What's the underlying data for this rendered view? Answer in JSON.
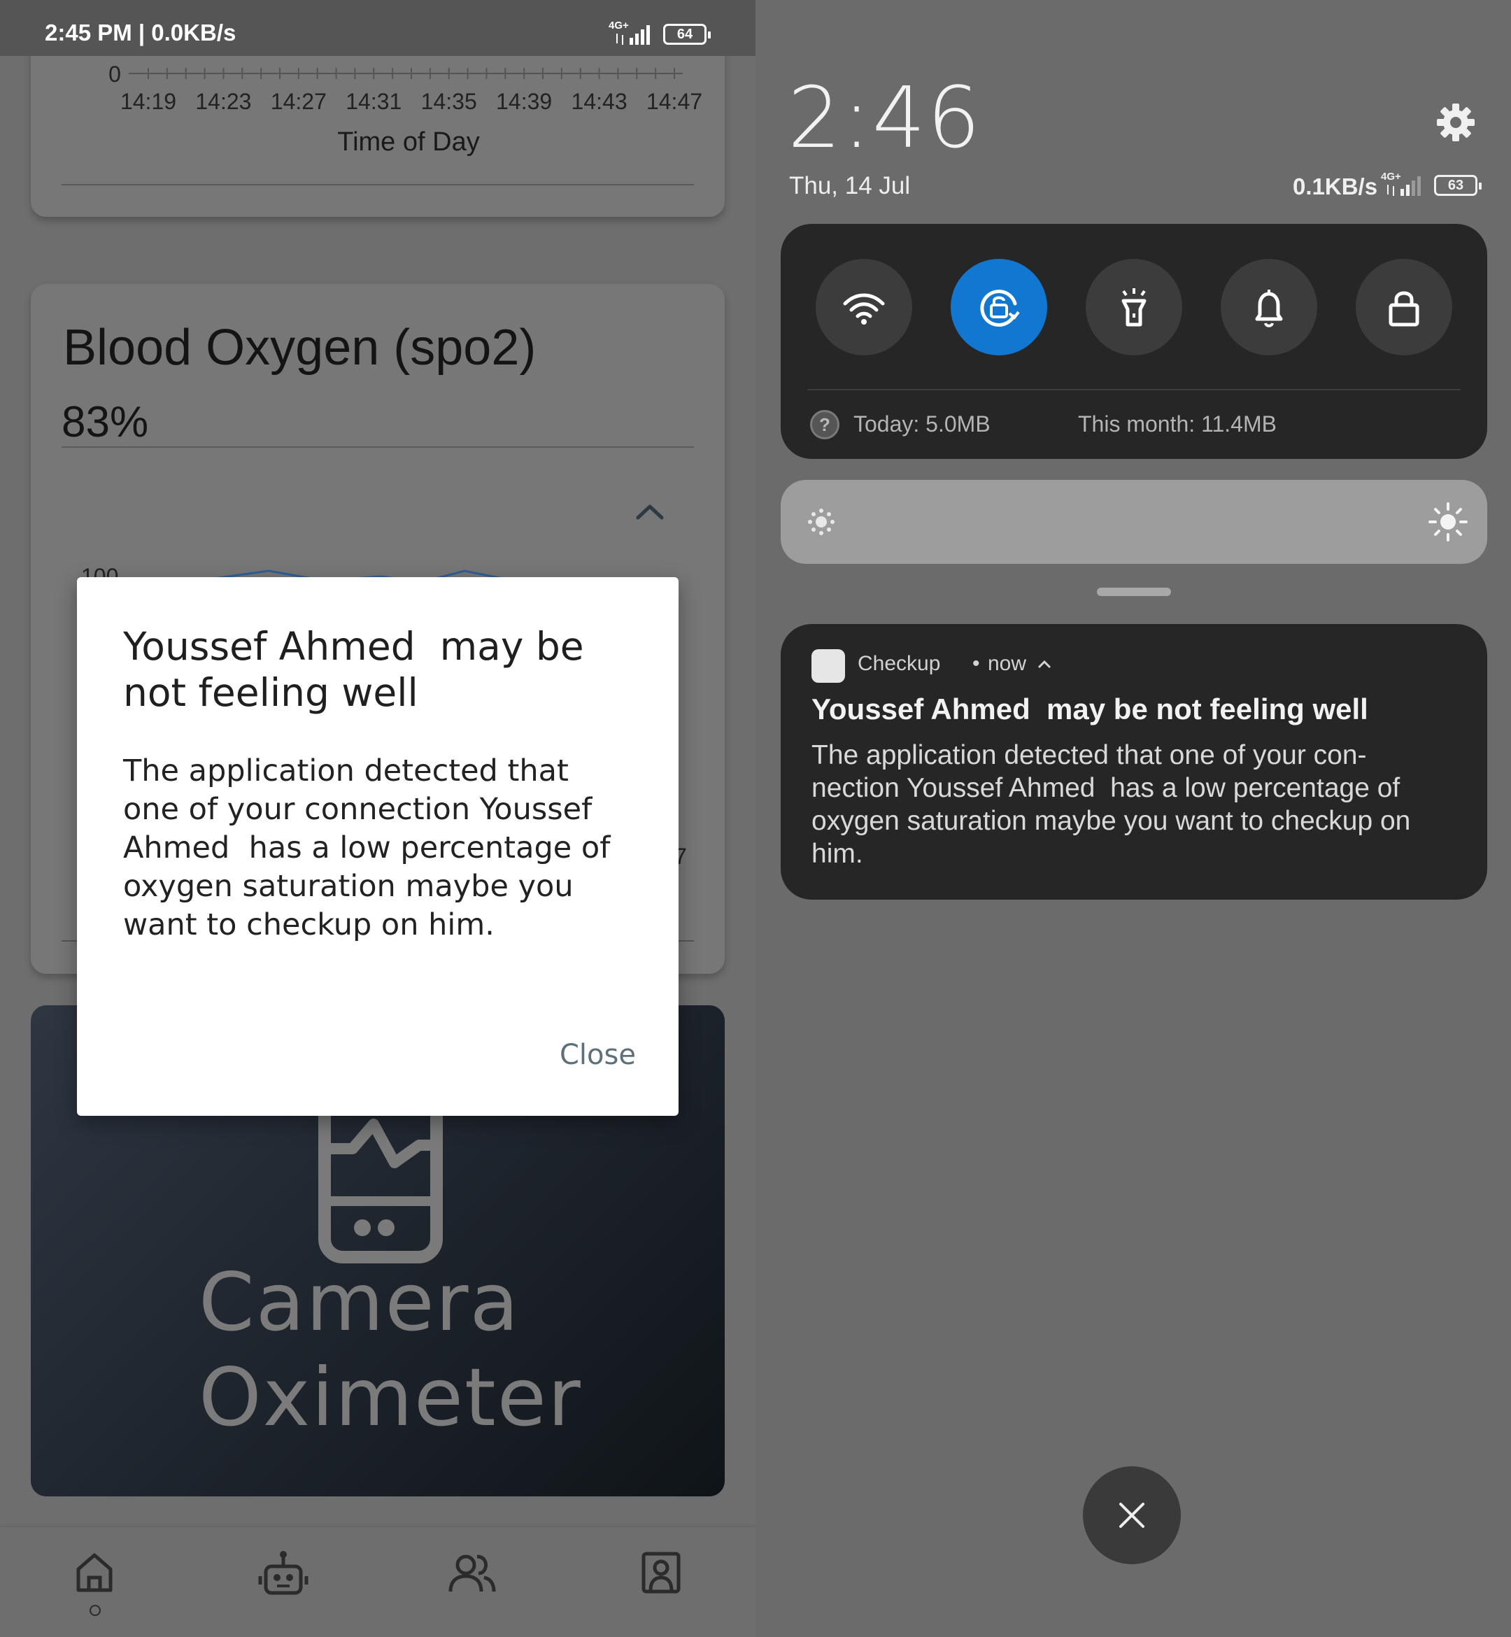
{
  "left_screen": {
    "status_bar": {
      "time_speed": "2:45 PM | 0.0KB/s",
      "network": "4G+",
      "battery": "64"
    },
    "top_chart_card": {
      "chart_data": {
        "type": "line",
        "x_ticks": [
          "14:19",
          "14:23",
          "14:27",
          "14:31",
          "14:35",
          "14:39",
          "14:43",
          "14:47"
        ],
        "y_ticks_visible": [
          0
        ],
        "xlabel": "Time of Day"
      }
    },
    "spo2_card": {
      "title": "Blood Oxygen (spo2)",
      "value": "83%",
      "chevron_icon": "chevron-up-icon",
      "partial_axis_label": "100",
      "partial_right_label": "7"
    },
    "camera_card": {
      "icon": "oximeter-icon",
      "title_line_1": "Camera",
      "title_line_2": "Oximeter"
    },
    "bottom_nav": {
      "items": [
        {
          "icon": "home-icon"
        },
        {
          "icon": "robot-icon"
        },
        {
          "icon": "people-icon"
        },
        {
          "icon": "profile-icon"
        }
      ]
    },
    "dialog": {
      "title": "Youssef Ahmed  may be\nnot feeling well",
      "body": "The application detected that\none of your connection Youssef\nAhmed  has a low percentage of\noxygen saturation maybe you\nwant to checkup on him.",
      "close_label": "Close"
    }
  },
  "right_screen": {
    "clock": "2:46",
    "date": "Thu, 14 Jul",
    "speed": "0.1KB/s",
    "network": "4G+",
    "battery": "63",
    "quick_settings": {
      "tiles": [
        {
          "icon": "wifi-icon",
          "active": false
        },
        {
          "icon": "rotation-lock-icon",
          "active": true,
          "color": "#1177d0"
        },
        {
          "icon": "flashlight-icon",
          "active": false
        },
        {
          "icon": "bell-icon",
          "active": false
        },
        {
          "icon": "lock-icon",
          "active": false
        }
      ],
      "data_today": "Today: 5.0MB",
      "data_month": "This month: 11.4MB",
      "help_glyph": "?"
    },
    "notification": {
      "app": "Checkup",
      "separator": "•",
      "time": "now",
      "title": "Youssef Ahmed  may be not feeling well",
      "body": "The application detected that one of your con-\nnection Youssef Ahmed  has a low percentage of\noxygen saturation maybe you want to checkup on\nhim."
    },
    "clear_button_icon": "close-icon"
  }
}
